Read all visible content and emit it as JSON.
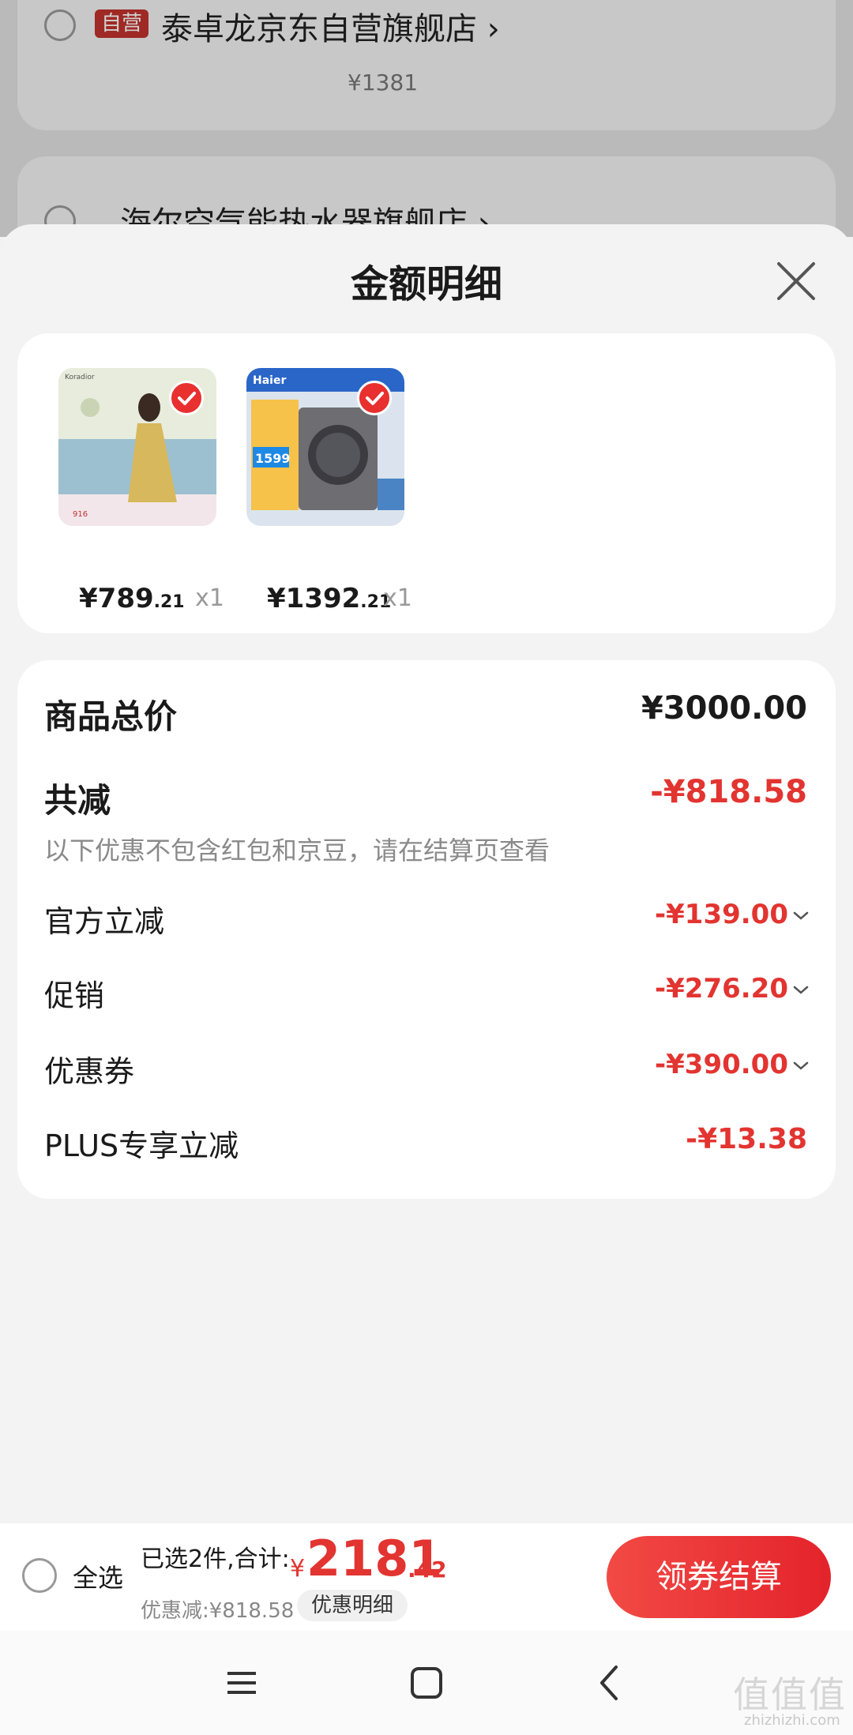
{
  "background": {
    "store_1": {
      "badge": "自营",
      "name": "泰卓龙京东自营旗舰店",
      "price": "¥1381"
    },
    "store_2": {
      "name": "海尔空气能热水器旗舰店"
    }
  },
  "sheet": {
    "title": "金额明细",
    "products": [
      {
        "price_int": "¥789",
        "price_dec": ".21",
        "qty": "x1",
        "image": "dress-model-product-image"
      },
      {
        "price_int": "¥1392",
        "price_dec": ".21",
        "qty": "x1",
        "image": "washing-machine-product-image"
      }
    ],
    "details": {
      "goods_total_label": "商品总价",
      "goods_total_value": "¥3000.00",
      "total_reduce_label": "共减",
      "total_reduce_value": "-¥818.58",
      "note": "以下优惠不包含红包和京豆，请在结算页查看",
      "items": [
        {
          "label": "官方立减",
          "value": "-¥139.00"
        },
        {
          "label": "促销",
          "value": "-¥276.20"
        },
        {
          "label": "优惠券",
          "value": "-¥390.00"
        },
        {
          "label": "PLUS专享立减",
          "value": "-¥13.38"
        }
      ]
    }
  },
  "bottom_bar": {
    "select_all": "全选",
    "summary": "已选2件,合计:",
    "currency": "¥",
    "total_int": "2181",
    "total_dec": ".42",
    "discount": "优惠减:¥818.58",
    "detail_pill": "优惠明细",
    "checkout": "领券结算"
  },
  "watermark": {
    "text": "值值值",
    "sub": "zhizhizhi.com"
  },
  "colors": {
    "accent": "#e23430",
    "checkout_start": "#f24a45",
    "checkout_end": "#e4232b"
  }
}
